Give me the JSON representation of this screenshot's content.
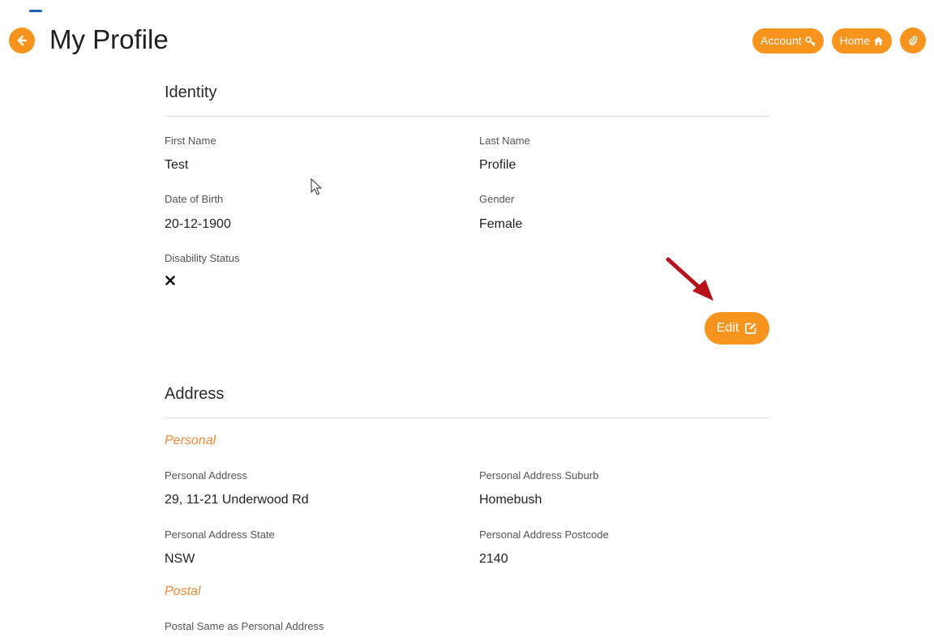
{
  "header": {
    "title": "My Profile",
    "buttons": {
      "account_label": "Account",
      "home_label": "Home"
    }
  },
  "identity": {
    "section_title": "Identity",
    "first_name": {
      "label": "First Name",
      "value": "Test"
    },
    "last_name": {
      "label": "Last Name",
      "value": "Profile"
    },
    "dob": {
      "label": "Date of Birth",
      "value": "20-12-1900"
    },
    "gender": {
      "label": "Gender",
      "value": "Female"
    },
    "disability": {
      "label": "Disability Status",
      "icon": "x-icon"
    },
    "edit_label": "Edit"
  },
  "address": {
    "section_title": "Address",
    "personal_heading": "Personal",
    "personal_address": {
      "label": "Personal Address",
      "value": "29, 11-21 Underwood Rd"
    },
    "personal_suburb": {
      "label": "Personal Address Suburb",
      "value": "Homebush"
    },
    "personal_state": {
      "label": "Personal Address State",
      "value": "NSW"
    },
    "personal_postcode": {
      "label": "Personal Address Postcode",
      "value": "2140"
    },
    "postal_heading": "Postal",
    "postal_same": {
      "label": "Postal Same as Personal Address"
    }
  },
  "colors": {
    "accent": "#f7941d",
    "subsection": "#f0883a",
    "annotation_arrow": "#b5121b"
  },
  "icons": {
    "back": "arrow-left-circle-icon",
    "account": "key-icon",
    "home": "home-icon",
    "extra": "paperclip-icon",
    "edit": "edit-icon"
  }
}
